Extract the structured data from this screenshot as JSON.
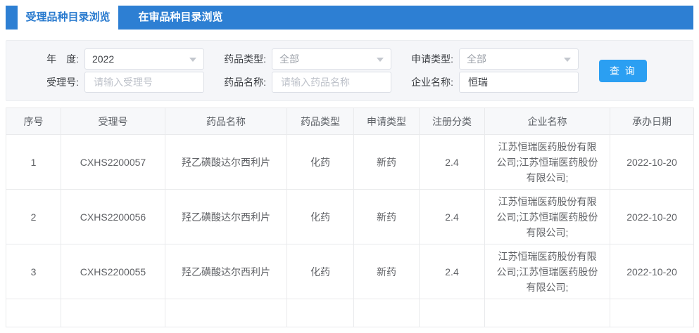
{
  "tabs": [
    {
      "label": "受理品种目录浏览",
      "active": true
    },
    {
      "label": "在审品种目录浏览",
      "active": false
    }
  ],
  "filters": {
    "year": {
      "label": "年　度:",
      "value": "2022"
    },
    "drug_type": {
      "label": "药品类型:",
      "value": "全部"
    },
    "apply_type": {
      "label": "申请类型:",
      "value": "全部"
    },
    "acceptance_no": {
      "label": "受理号:",
      "placeholder": "请输入受理号"
    },
    "drug_name": {
      "label": "药品名称:",
      "placeholder": "请输入药品名称"
    },
    "company": {
      "label": "企业名称:",
      "value": "恒瑞"
    },
    "search_label": "查 询"
  },
  "table": {
    "columns": [
      "序号",
      "受理号",
      "药品名称",
      "药品类型",
      "申请类型",
      "注册分类",
      "企业名称",
      "承办日期"
    ],
    "rows": [
      [
        "1",
        "CXHS2200057",
        "羟乙磺酸达尔西利片",
        "化药",
        "新药",
        "2.4",
        "江苏恒瑞医药股份有限公司;江苏恒瑞医药股份有限公司;",
        "2022-10-20"
      ],
      [
        "2",
        "CXHS2200056",
        "羟乙磺酸达尔西利片",
        "化药",
        "新药",
        "2.4",
        "江苏恒瑞医药股份有限公司;江苏恒瑞医药股份有限公司;",
        "2022-10-20"
      ],
      [
        "3",
        "CXHS2200055",
        "羟乙磺酸达尔西利片",
        "化药",
        "新药",
        "2.4",
        "江苏恒瑞医药股份有限公司;江苏恒瑞医药股份有限公司;",
        "2022-10-20"
      ]
    ]
  },
  "colors": {
    "tab_bar_blue": "#2d7fd3",
    "active_tab_text": "#2779ce",
    "search_button_blue": "#2b9ff2",
    "panel_background": "#f5f6f9",
    "table_border": "#e9eaec",
    "header_background": "#f7f8fa",
    "body_text": "#606266"
  },
  "icons": {
    "dropdown_caret": "caret-down"
  }
}
